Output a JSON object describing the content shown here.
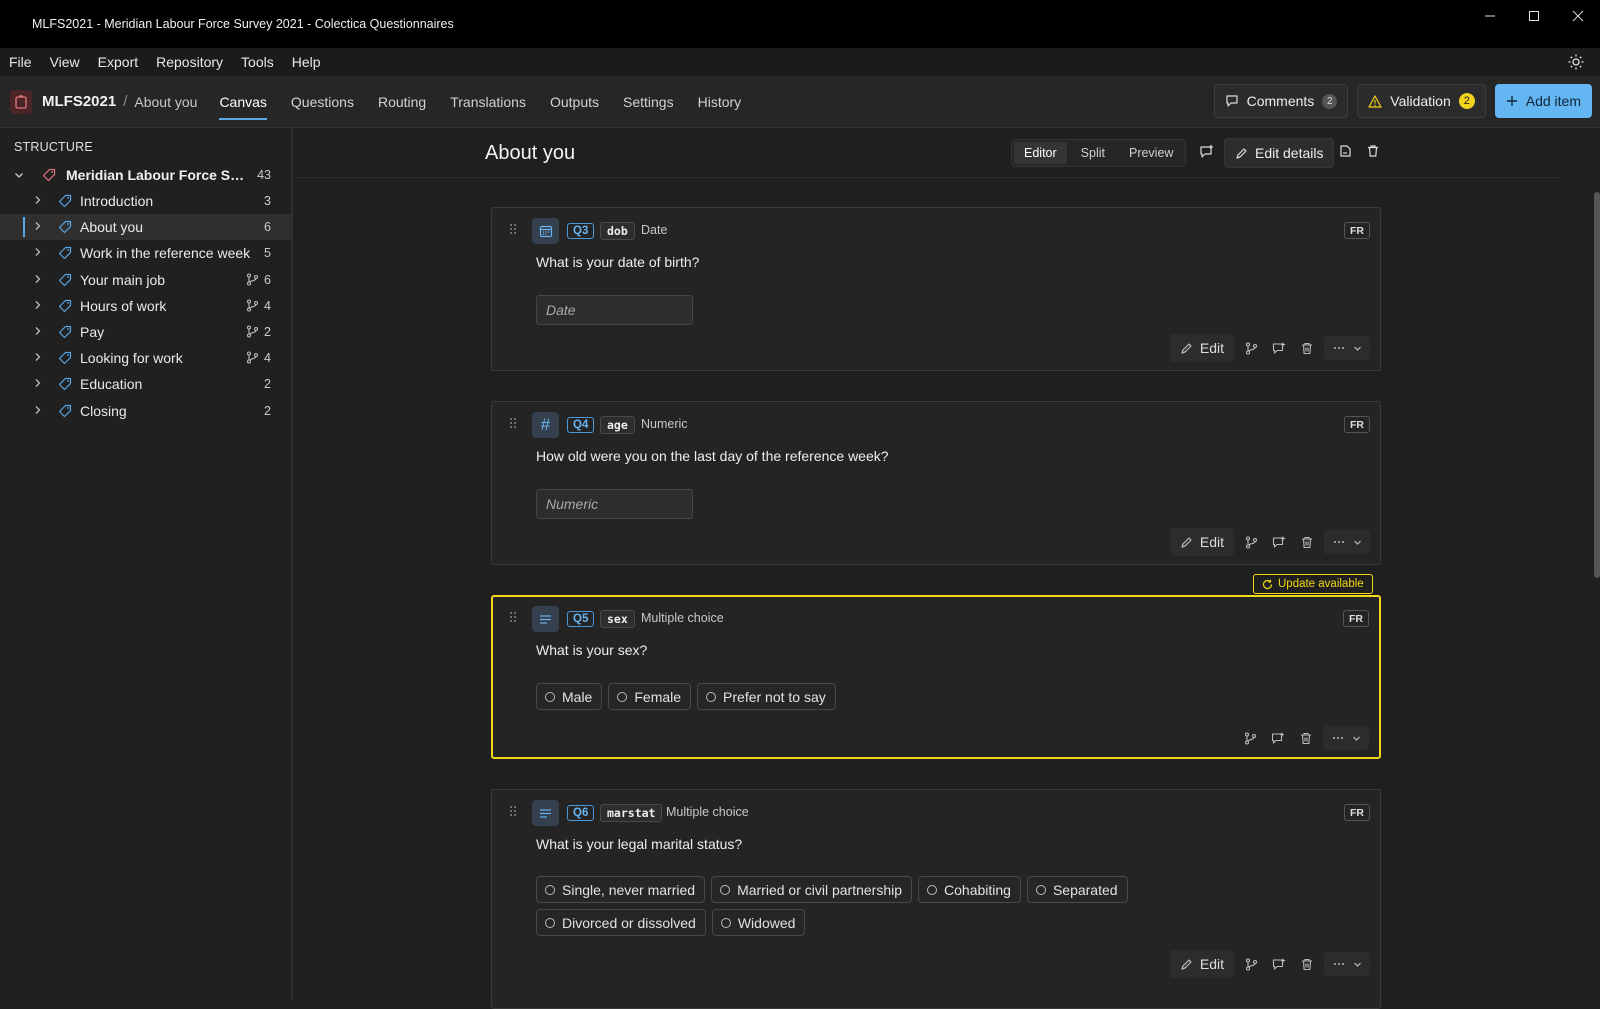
{
  "window": {
    "title": "MLFS2021 - Meridian Labour Force Survey 2021 - Colectica Questionnaires"
  },
  "menu": [
    "File",
    "View",
    "Export",
    "Repository",
    "Tools",
    "Help"
  ],
  "header": {
    "project": "MLFS2021",
    "separator": "/",
    "page": "About you",
    "tabs": [
      "Canvas",
      "Questions",
      "Routing",
      "Translations",
      "Outputs",
      "Settings",
      "History"
    ],
    "active_tab": "Canvas",
    "comments_label": "Comments",
    "comments_count": "2",
    "validation_label": "Validation",
    "validation_count": "2",
    "add_item_label": "Add item",
    "accent": "#64b6f2"
  },
  "sidebar": {
    "label": "STRUCTURE",
    "root": {
      "name": "Meridian Labour Force Survey 2021",
      "display": "Meridian Labour Force Sur...",
      "count": "43"
    },
    "items": [
      {
        "name": "Introduction",
        "count": "3",
        "routing": false
      },
      {
        "name": "About you",
        "count": "6",
        "routing": false,
        "selected": true
      },
      {
        "name": "Work in the reference week",
        "count": "5",
        "routing": false
      },
      {
        "name": "Your main job",
        "count": "6",
        "routing": true
      },
      {
        "name": "Hours of work",
        "count": "4",
        "routing": true
      },
      {
        "name": "Pay",
        "count": "2",
        "routing": true
      },
      {
        "name": "Looking for work",
        "count": "4",
        "routing": true
      },
      {
        "name": "Education",
        "count": "2",
        "routing": false
      },
      {
        "name": "Closing",
        "count": "2",
        "routing": false
      }
    ]
  },
  "canvas": {
    "title": "About you",
    "views": [
      "Editor",
      "Split",
      "Preview"
    ],
    "active_view": "Editor",
    "edit_details_label": "Edit details",
    "update_label": "Update available",
    "highlight_color": "#f1d716",
    "questions": [
      {
        "id": "Q3",
        "var": "dob",
        "type": "Date",
        "icon": "calendar-icon",
        "lang": "FR",
        "text": "What is your date of birth?",
        "placeholder": "Date",
        "edit_label": "Edit"
      },
      {
        "id": "Q4",
        "var": "age",
        "type": "Numeric",
        "icon": "hash-icon",
        "lang": "FR",
        "text": "How old were you on the last day of the reference week?",
        "placeholder": "Numeric",
        "edit_label": "Edit"
      },
      {
        "id": "Q5",
        "var": "sex",
        "type": "Multiple choice",
        "icon": "list-icon",
        "lang": "FR",
        "text": "What is your sex?",
        "options": [
          "Male",
          "Female",
          "Prefer not to say"
        ]
      },
      {
        "id": "Q6",
        "var": "marstat",
        "type": "Multiple choice",
        "icon": "list-icon",
        "lang": "FR",
        "text": "What is your legal marital status?",
        "options": [
          "Single, never married",
          "Married or civil partnership",
          "Cohabiting",
          "Separated",
          "Divorced or dissolved",
          "Widowed"
        ],
        "edit_label": "Edit"
      }
    ]
  }
}
